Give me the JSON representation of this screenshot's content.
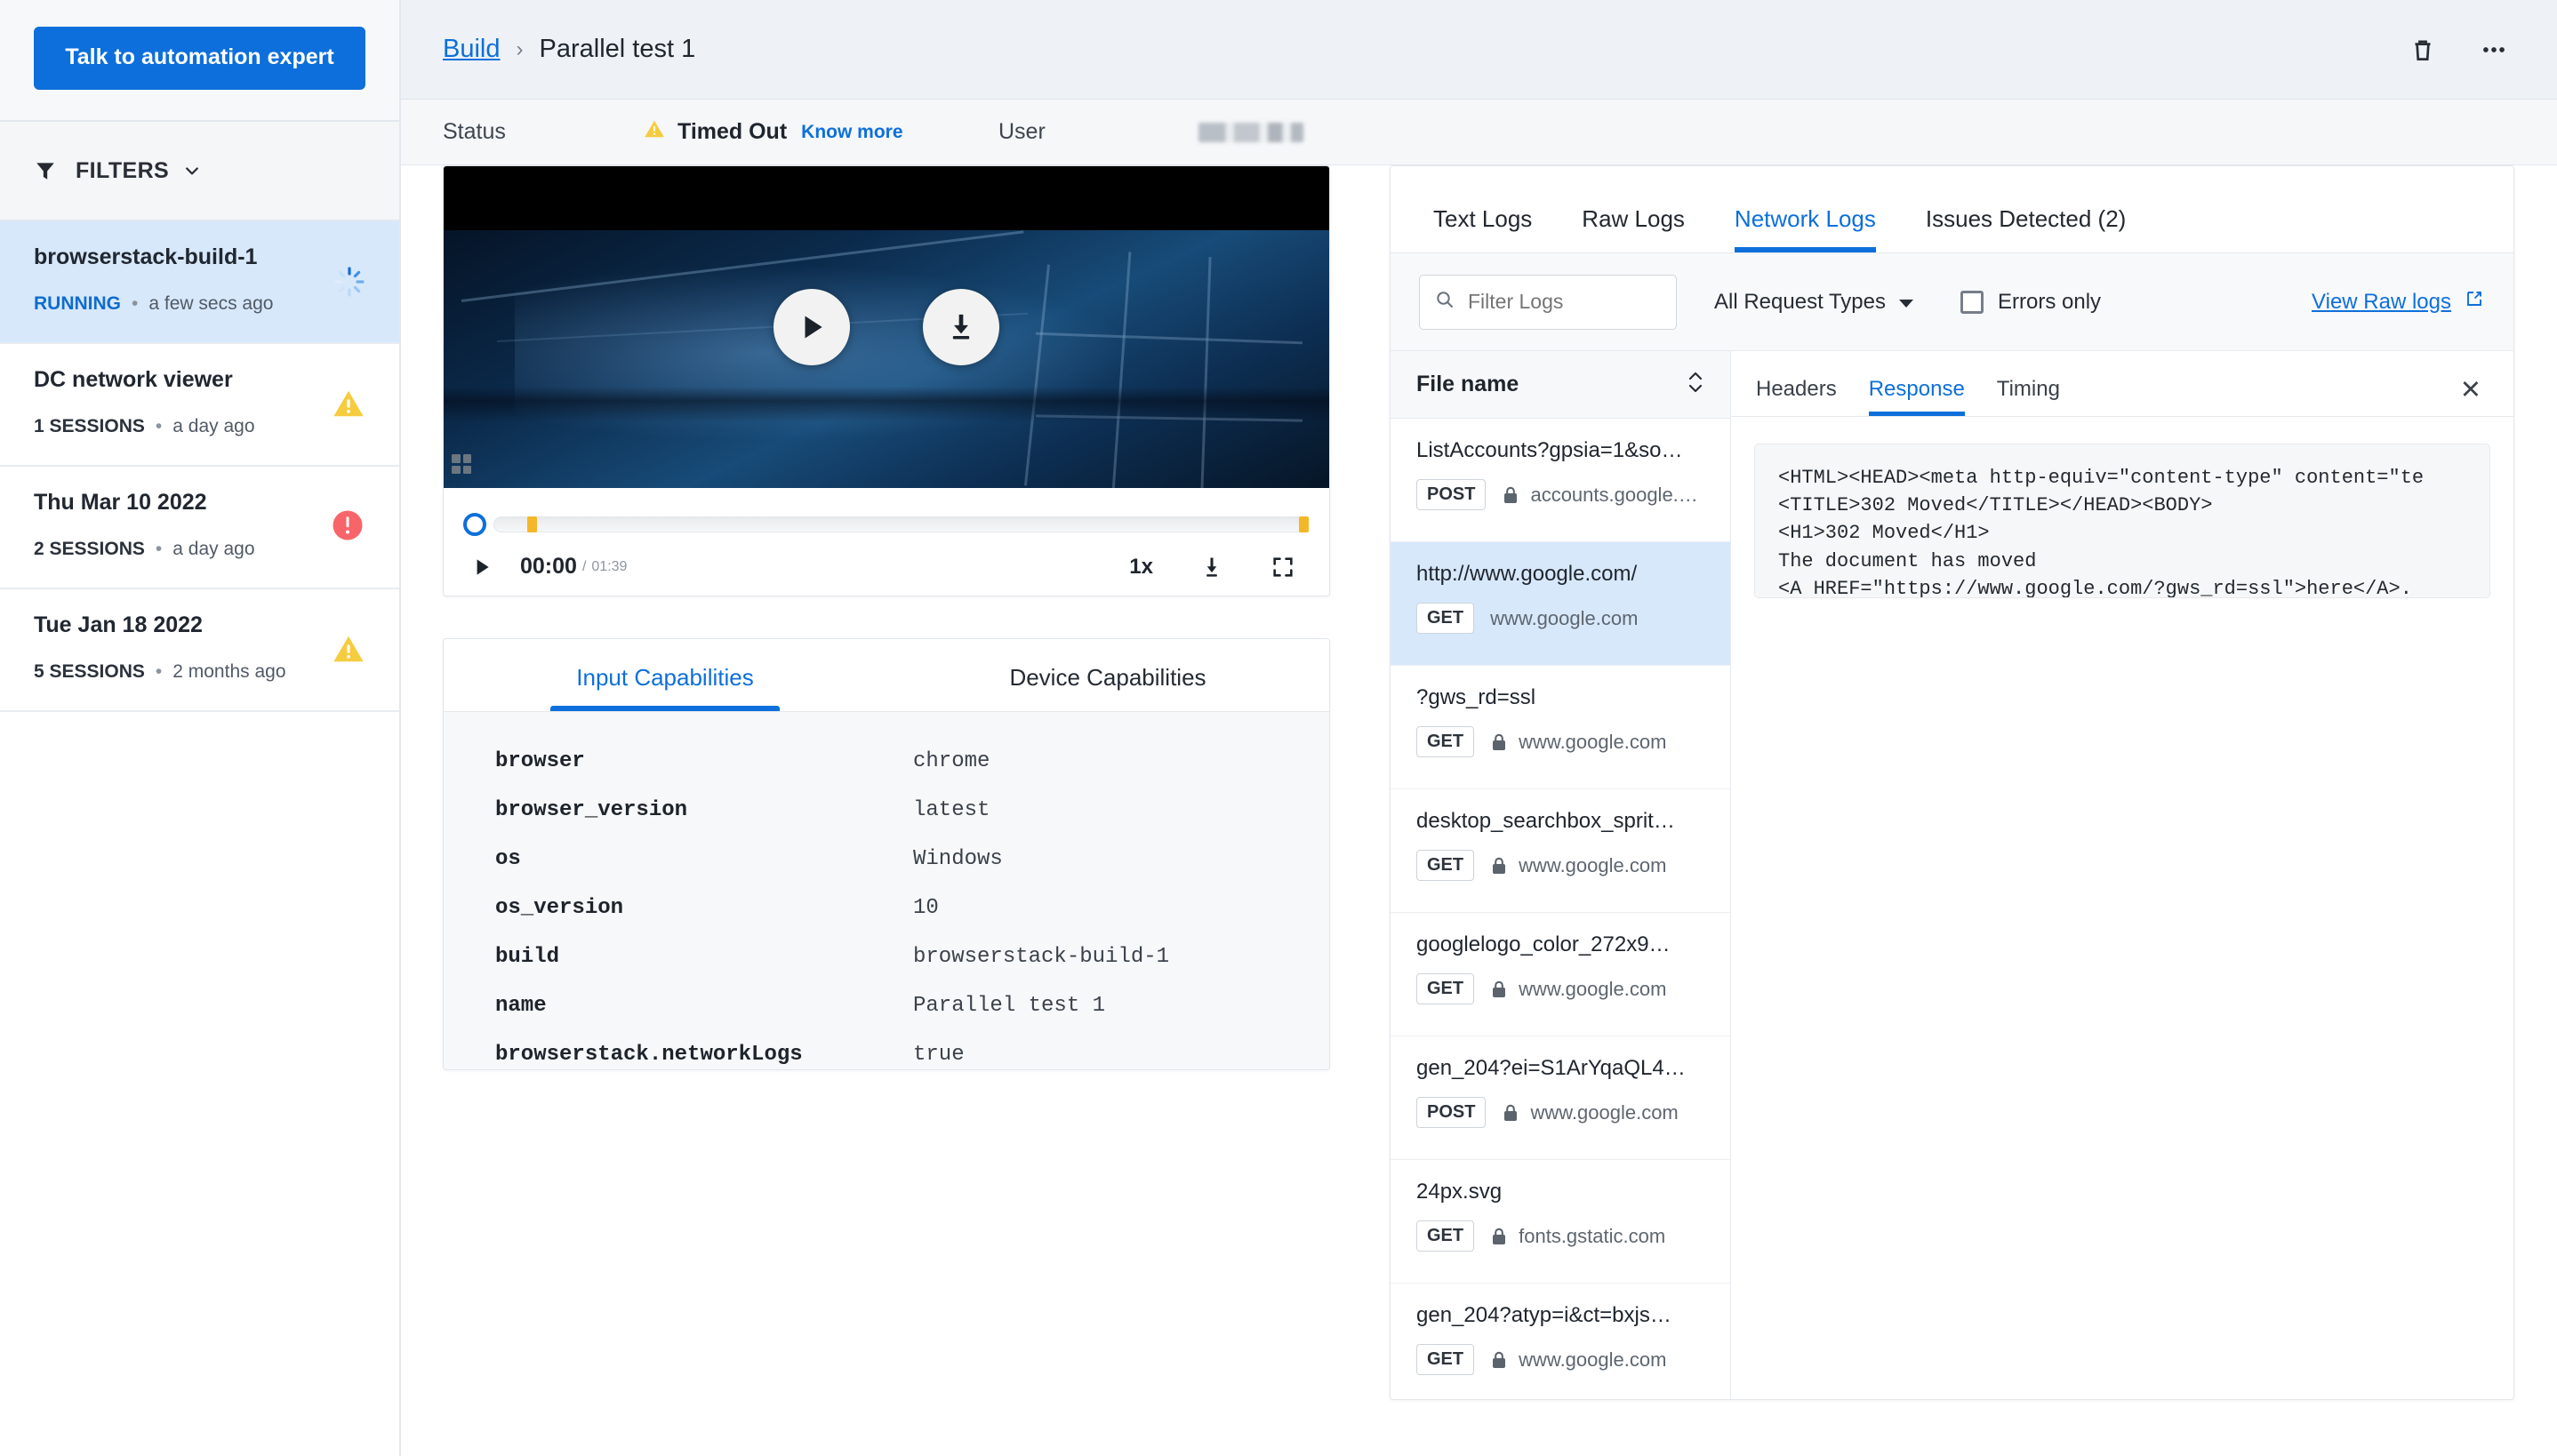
{
  "sidebar": {
    "cta_label": "Talk to automation expert",
    "filters_label": "FILTERS",
    "builds": [
      {
        "name": "browserstack-build-1",
        "sessions": "RUNNING",
        "dot": "•",
        "time": "a few secs ago",
        "status": "spinner",
        "selected": true
      },
      {
        "name": "DC network viewer",
        "sessions": "1 SESSIONS",
        "dot": "•",
        "time": "a day ago",
        "status": "warning",
        "selected": false
      },
      {
        "name": "Thu Mar 10 2022",
        "sessions": "2 SESSIONS",
        "dot": "•",
        "time": "a day ago",
        "status": "error",
        "selected": false
      },
      {
        "name": "Tue Jan 18 2022",
        "sessions": "5 SESSIONS",
        "dot": "•",
        "time": "2 months ago",
        "status": "warning",
        "selected": false
      }
    ]
  },
  "topbar": {
    "breadcrumb_root": "Build",
    "breadcrumb_sep": "›",
    "breadcrumb_current": "Parallel test 1",
    "delete_icon": "trash-icon",
    "more_icon": "ellipsis-icon"
  },
  "statusbar": {
    "status_label": "Status",
    "status_value": "Timed Out",
    "know_more": "Know more",
    "user_label": "User",
    "user_value": ""
  },
  "video": {
    "play_icon": "play-icon",
    "download_icon": "download-icon",
    "current_time": "00:00",
    "time_separator": "/",
    "total_time": "01:39",
    "speed": "1x",
    "download_ctrl_icon": "download-icon",
    "fullscreen_icon": "fullscreen-icon"
  },
  "capabilities": {
    "tabs": [
      {
        "label": "Input Capabilities",
        "active": true
      },
      {
        "label": "Device Capabilities",
        "active": false
      }
    ],
    "rows": [
      {
        "key": "browser",
        "value": "chrome"
      },
      {
        "key": "browser_version",
        "value": "latest"
      },
      {
        "key": "os",
        "value": "Windows"
      },
      {
        "key": "os_version",
        "value": "10"
      },
      {
        "key": "build",
        "value": "browserstack-build-1"
      },
      {
        "key": "name",
        "value": "Parallel test 1"
      },
      {
        "key": "browserstack.networkLogs",
        "value": "true"
      }
    ]
  },
  "logs": {
    "tabs": [
      {
        "label": "Text Logs",
        "active": false
      },
      {
        "label": "Raw Logs",
        "active": false
      },
      {
        "label": "Network Logs",
        "active": true
      },
      {
        "label": "Issues Detected (2)",
        "active": false
      }
    ],
    "filter_placeholder": "Filter Logs",
    "request_type": "All Request Types",
    "errors_only_label": "Errors only",
    "errors_only_checked": false,
    "view_raw_label": "View Raw logs",
    "file_column_header": "File name",
    "files": [
      {
        "name": "ListAccounts?gpsia=1&so…",
        "method": "POST",
        "secure": true,
        "host": "accounts.google.…",
        "selected": false
      },
      {
        "name": "http://www.google.com/",
        "method": "GET",
        "secure": false,
        "host": "www.google.com",
        "selected": true
      },
      {
        "name": "?gws_rd=ssl",
        "method": "GET",
        "secure": true,
        "host": "www.google.com",
        "selected": false
      },
      {
        "name": "desktop_searchbox_sprit…",
        "method": "GET",
        "secure": true,
        "host": "www.google.com",
        "selected": false
      },
      {
        "name": "googlelogo_color_272x9…",
        "method": "GET",
        "secure": true,
        "host": "www.google.com",
        "selected": false
      },
      {
        "name": "gen_204?ei=S1ArYqaQL4…",
        "method": "POST",
        "secure": true,
        "host": "www.google.com",
        "selected": false
      },
      {
        "name": "24px.svg",
        "method": "GET",
        "secure": true,
        "host": "fonts.gstatic.com",
        "selected": false
      },
      {
        "name": "gen_204?atyp=i&ct=bxjs…",
        "method": "GET",
        "secure": true,
        "host": "www.google.com",
        "selected": false
      }
    ],
    "detail_tabs": [
      {
        "label": "Headers",
        "active": false
      },
      {
        "label": "Response",
        "active": true
      },
      {
        "label": "Timing",
        "active": false
      }
    ],
    "close_label": "✕",
    "response_body": "<HTML><HEAD><meta http-equiv=\"content-type\" content=\"te\n<TITLE>302 Moved</TITLE></HEAD><BODY>\n<H1>302 Moved</H1>\nThe document has moved\n<A HREF=\"https://www.google.com/?gws_rd=ssl\">here</A>.\n</BODY></HTML>"
  },
  "colors": {
    "accent": "#0d6fdb",
    "warning": "#f5c542",
    "error": "#f25c5c",
    "selected_row": "#d7e8fb"
  }
}
